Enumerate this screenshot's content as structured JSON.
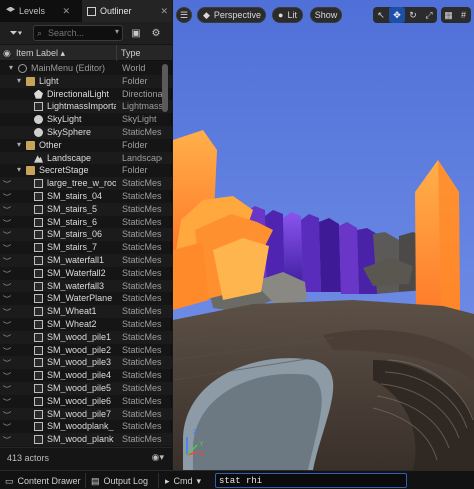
{
  "tabs": {
    "levels": "Levels",
    "outliner": "Outliner",
    "close_glyph": "✕"
  },
  "toolbar": {
    "search_placeholder": "Search..."
  },
  "columns": {
    "item_label": "Item Label ▴",
    "type": "Type"
  },
  "rows": [
    {
      "name": "MainMenu (Editor)",
      "type": "World",
      "icon": "world-icon",
      "dim": true
    },
    {
      "name": "Light",
      "type": "Folder",
      "icon": "folder-icon"
    },
    {
      "name": "DirectionalLight",
      "type": "DirectionalLight",
      "icon": "light-icon"
    },
    {
      "name": "LightmassImportanceVolume",
      "type": "LightmassImportanceVolume",
      "icon": "cube-icon"
    },
    {
      "name": "SkyLight",
      "type": "SkyLight",
      "icon": "skylight-icon"
    },
    {
      "name": "SkySphere",
      "type": "StaticMeshActor",
      "icon": "sphere-icon"
    },
    {
      "name": "Other",
      "type": "Folder",
      "icon": "folder-icon"
    },
    {
      "name": "Landscape",
      "type": "Landscape",
      "icon": "landscape-icon"
    },
    {
      "name": "SecretStage",
      "type": "Folder",
      "icon": "folder-icon"
    },
    {
      "name": "large_tree_w_roots",
      "type": "StaticMeshActor",
      "icon": "cube-icon"
    },
    {
      "name": "SM_stairs_04",
      "type": "StaticMeshActor",
      "icon": "cube-icon"
    },
    {
      "name": "SM_stairs_5",
      "type": "StaticMeshActor",
      "icon": "cube-icon"
    },
    {
      "name": "SM_stairs_6",
      "type": "StaticMeshActor",
      "icon": "cube-icon"
    },
    {
      "name": "SM_stairs_06",
      "type": "StaticMeshActor",
      "icon": "cube-icon"
    },
    {
      "name": "SM_stairs_7",
      "type": "StaticMeshActor",
      "icon": "cube-icon"
    },
    {
      "name": "SM_waterfall1",
      "type": "StaticMeshActor",
      "icon": "cube-icon"
    },
    {
      "name": "SM_Waterfall2",
      "type": "StaticMeshActor",
      "icon": "cube-icon"
    },
    {
      "name": "SM_waterfall3",
      "type": "StaticMeshActor",
      "icon": "cube-icon"
    },
    {
      "name": "SM_WaterPlane",
      "type": "StaticMeshActor",
      "icon": "cube-icon"
    },
    {
      "name": "SM_Wheat1",
      "type": "StaticMeshActor",
      "icon": "cube-icon"
    },
    {
      "name": "SM_Wheat2",
      "type": "StaticMeshActor",
      "icon": "cube-icon"
    },
    {
      "name": "SM_wood_pile1",
      "type": "StaticMeshActor",
      "icon": "cube-icon"
    },
    {
      "name": "SM_wood_pile2",
      "type": "StaticMeshActor",
      "icon": "cube-icon"
    },
    {
      "name": "SM_wood_pile3",
      "type": "StaticMeshActor",
      "icon": "cube-icon"
    },
    {
      "name": "SM_wood_pile4",
      "type": "StaticMeshActor",
      "icon": "cube-icon"
    },
    {
      "name": "SM_wood_pile5",
      "type": "StaticMeshActor",
      "icon": "cube-icon"
    },
    {
      "name": "SM_wood_pile6",
      "type": "StaticMeshActor",
      "icon": "cube-icon"
    },
    {
      "name": "SM_wood_pile7",
      "type": "StaticMeshActor",
      "icon": "cube-icon"
    },
    {
      "name": "SM_woodplank_",
      "type": "StaticMeshActor",
      "icon": "cube-icon"
    },
    {
      "name": "SM_wood_plank",
      "type": "StaticMeshActor",
      "icon": "cube-icon"
    }
  ],
  "footer": {
    "actor_count": "413 actors"
  },
  "viewport": {
    "menu_glyph": "☰",
    "perspective": "Perspective",
    "lit": "Lit",
    "show": "Show",
    "axis_z": "Z",
    "axis_x": "X",
    "axis_y": "Y"
  },
  "bottombar": {
    "content_drawer": "Content Drawer",
    "output_log": "Output Log",
    "cmd": "Cmd",
    "cmd_value": "stat rhi"
  },
  "colors": {
    "accent": "#2f5fb8",
    "sky": "#5b7de0",
    "crystal_orange": "#ff9a3a",
    "crystal_purple": "#7a3fd8"
  }
}
